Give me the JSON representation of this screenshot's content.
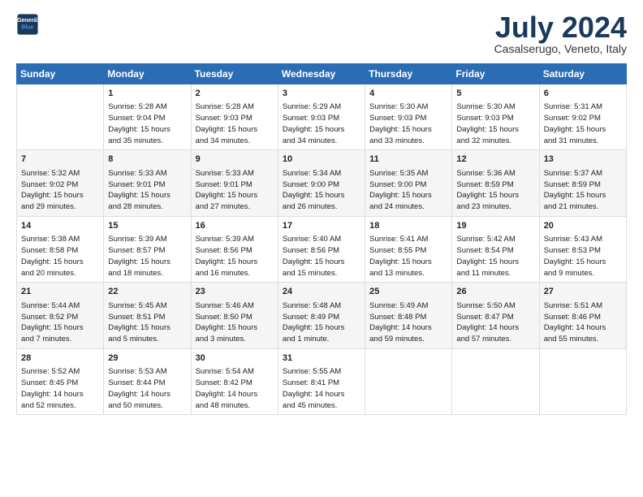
{
  "header": {
    "logo_line1": "General",
    "logo_line2": "Blue",
    "month": "July 2024",
    "location": "Casalserugo, Veneto, Italy"
  },
  "weekdays": [
    "Sunday",
    "Monday",
    "Tuesday",
    "Wednesday",
    "Thursday",
    "Friday",
    "Saturday"
  ],
  "weeks": [
    [
      {
        "day": "",
        "info": ""
      },
      {
        "day": "1",
        "info": "Sunrise: 5:28 AM\nSunset: 9:04 PM\nDaylight: 15 hours\nand 35 minutes."
      },
      {
        "day": "2",
        "info": "Sunrise: 5:28 AM\nSunset: 9:03 PM\nDaylight: 15 hours\nand 34 minutes."
      },
      {
        "day": "3",
        "info": "Sunrise: 5:29 AM\nSunset: 9:03 PM\nDaylight: 15 hours\nand 34 minutes."
      },
      {
        "day": "4",
        "info": "Sunrise: 5:30 AM\nSunset: 9:03 PM\nDaylight: 15 hours\nand 33 minutes."
      },
      {
        "day": "5",
        "info": "Sunrise: 5:30 AM\nSunset: 9:03 PM\nDaylight: 15 hours\nand 32 minutes."
      },
      {
        "day": "6",
        "info": "Sunrise: 5:31 AM\nSunset: 9:02 PM\nDaylight: 15 hours\nand 31 minutes."
      }
    ],
    [
      {
        "day": "7",
        "info": "Sunrise: 5:32 AM\nSunset: 9:02 PM\nDaylight: 15 hours\nand 29 minutes."
      },
      {
        "day": "8",
        "info": "Sunrise: 5:33 AM\nSunset: 9:01 PM\nDaylight: 15 hours\nand 28 minutes."
      },
      {
        "day": "9",
        "info": "Sunrise: 5:33 AM\nSunset: 9:01 PM\nDaylight: 15 hours\nand 27 minutes."
      },
      {
        "day": "10",
        "info": "Sunrise: 5:34 AM\nSunset: 9:00 PM\nDaylight: 15 hours\nand 26 minutes."
      },
      {
        "day": "11",
        "info": "Sunrise: 5:35 AM\nSunset: 9:00 PM\nDaylight: 15 hours\nand 24 minutes."
      },
      {
        "day": "12",
        "info": "Sunrise: 5:36 AM\nSunset: 8:59 PM\nDaylight: 15 hours\nand 23 minutes."
      },
      {
        "day": "13",
        "info": "Sunrise: 5:37 AM\nSunset: 8:59 PM\nDaylight: 15 hours\nand 21 minutes."
      }
    ],
    [
      {
        "day": "14",
        "info": "Sunrise: 5:38 AM\nSunset: 8:58 PM\nDaylight: 15 hours\nand 20 minutes."
      },
      {
        "day": "15",
        "info": "Sunrise: 5:39 AM\nSunset: 8:57 PM\nDaylight: 15 hours\nand 18 minutes."
      },
      {
        "day": "16",
        "info": "Sunrise: 5:39 AM\nSunset: 8:56 PM\nDaylight: 15 hours\nand 16 minutes."
      },
      {
        "day": "17",
        "info": "Sunrise: 5:40 AM\nSunset: 8:56 PM\nDaylight: 15 hours\nand 15 minutes."
      },
      {
        "day": "18",
        "info": "Sunrise: 5:41 AM\nSunset: 8:55 PM\nDaylight: 15 hours\nand 13 minutes."
      },
      {
        "day": "19",
        "info": "Sunrise: 5:42 AM\nSunset: 8:54 PM\nDaylight: 15 hours\nand 11 minutes."
      },
      {
        "day": "20",
        "info": "Sunrise: 5:43 AM\nSunset: 8:53 PM\nDaylight: 15 hours\nand 9 minutes."
      }
    ],
    [
      {
        "day": "21",
        "info": "Sunrise: 5:44 AM\nSunset: 8:52 PM\nDaylight: 15 hours\nand 7 minutes."
      },
      {
        "day": "22",
        "info": "Sunrise: 5:45 AM\nSunset: 8:51 PM\nDaylight: 15 hours\nand 5 minutes."
      },
      {
        "day": "23",
        "info": "Sunrise: 5:46 AM\nSunset: 8:50 PM\nDaylight: 15 hours\nand 3 minutes."
      },
      {
        "day": "24",
        "info": "Sunrise: 5:48 AM\nSunset: 8:49 PM\nDaylight: 15 hours\nand 1 minute."
      },
      {
        "day": "25",
        "info": "Sunrise: 5:49 AM\nSunset: 8:48 PM\nDaylight: 14 hours\nand 59 minutes."
      },
      {
        "day": "26",
        "info": "Sunrise: 5:50 AM\nSunset: 8:47 PM\nDaylight: 14 hours\nand 57 minutes."
      },
      {
        "day": "27",
        "info": "Sunrise: 5:51 AM\nSunset: 8:46 PM\nDaylight: 14 hours\nand 55 minutes."
      }
    ],
    [
      {
        "day": "28",
        "info": "Sunrise: 5:52 AM\nSunset: 8:45 PM\nDaylight: 14 hours\nand 52 minutes."
      },
      {
        "day": "29",
        "info": "Sunrise: 5:53 AM\nSunset: 8:44 PM\nDaylight: 14 hours\nand 50 minutes."
      },
      {
        "day": "30",
        "info": "Sunrise: 5:54 AM\nSunset: 8:42 PM\nDaylight: 14 hours\nand 48 minutes."
      },
      {
        "day": "31",
        "info": "Sunrise: 5:55 AM\nSunset: 8:41 PM\nDaylight: 14 hours\nand 45 minutes."
      },
      {
        "day": "",
        "info": ""
      },
      {
        "day": "",
        "info": ""
      },
      {
        "day": "",
        "info": ""
      }
    ]
  ]
}
